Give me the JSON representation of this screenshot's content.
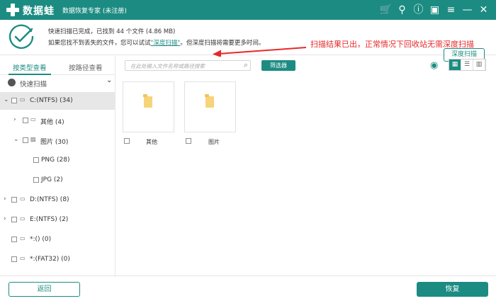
{
  "titlebar": {
    "brand": "数据蛙",
    "subtitle": "数据恢复专家 (未注册)",
    "icons": [
      "cart-icon",
      "key-icon",
      "help-icon",
      "save-icon",
      "menu-icon",
      "minimize-icon",
      "close-icon"
    ]
  },
  "scan": {
    "line1": "快速扫描已完成，已找到 44 个文件 (4.86 MB)",
    "line2_pre": "如果您找不到丢失的文件，您可以试试",
    "line2_link": "\"深度扫描\"",
    "line2_post": "。但深度扫描将需要更多时间。",
    "annotation": "扫描结果已出，正常情况下回收站无需深度扫描",
    "deep_button": "深度扫描"
  },
  "sidebar": {
    "tab_type": "按类型查看",
    "tab_path": "按路径查看",
    "quick_scan": "快速扫描",
    "tree": [
      {
        "label": "C:(NTFS) (34)",
        "icon": "drive-icon",
        "expand": "down",
        "selected": true
      },
      {
        "label": "其他 (4)",
        "icon": "folder-icon",
        "expand": "right"
      },
      {
        "label": "图片 (30)",
        "icon": "image-icon",
        "expand": "down"
      },
      {
        "label": "PNG (28)",
        "icon": "",
        "expand": ""
      },
      {
        "label": "JPG (2)",
        "icon": "",
        "expand": ""
      },
      {
        "label": "D:(NTFS) (8)",
        "icon": "drive-icon",
        "expand": "right"
      },
      {
        "label": "E:(NTFS) (2)",
        "icon": "drive-icon",
        "expand": "right"
      },
      {
        "label": "*:() (0)",
        "icon": "drive-icon",
        "expand": ""
      },
      {
        "label": "*:(FAT32) (0)",
        "icon": "drive-icon",
        "expand": ""
      }
    ]
  },
  "toolbar": {
    "search_placeholder": "在此处输入文件名称或路径搜索",
    "filter_button": "筛选器"
  },
  "files": [
    {
      "name": "其他"
    },
    {
      "name": "图片"
    }
  ],
  "footer": {
    "back_button": "返回",
    "restore_button": "恢复"
  },
  "colors": {
    "accent": "#1c8c82",
    "annotation": "#e8282a",
    "folder": "#f7d37a"
  }
}
